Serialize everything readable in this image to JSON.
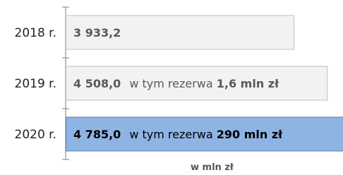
{
  "chart_data": {
    "type": "bar",
    "orientation": "horizontal",
    "categories": [
      "2018 r.",
      "2019 r.",
      "2020 r."
    ],
    "values": [
      3933.2,
      4508.0,
      4785.0
    ],
    "value_labels": [
      "3 933,2",
      "4 508,0",
      "4 785,0"
    ],
    "annotations": [
      {
        "prefix": "",
        "bold": ""
      },
      {
        "prefix": "w tym rezerwa ",
        "bold": "1,6 mln zł"
      },
      {
        "prefix": "w tym rezerwa ",
        "bold": "290 mln zł"
      }
    ],
    "highlight_index": 2,
    "colors": {
      "bar": "#f2f2f2",
      "bar_border": "#bfbfbf",
      "highlight": "#8eb4e3",
      "highlight_border": "#5b7fa8"
    },
    "xlabel": "w mln zł"
  }
}
